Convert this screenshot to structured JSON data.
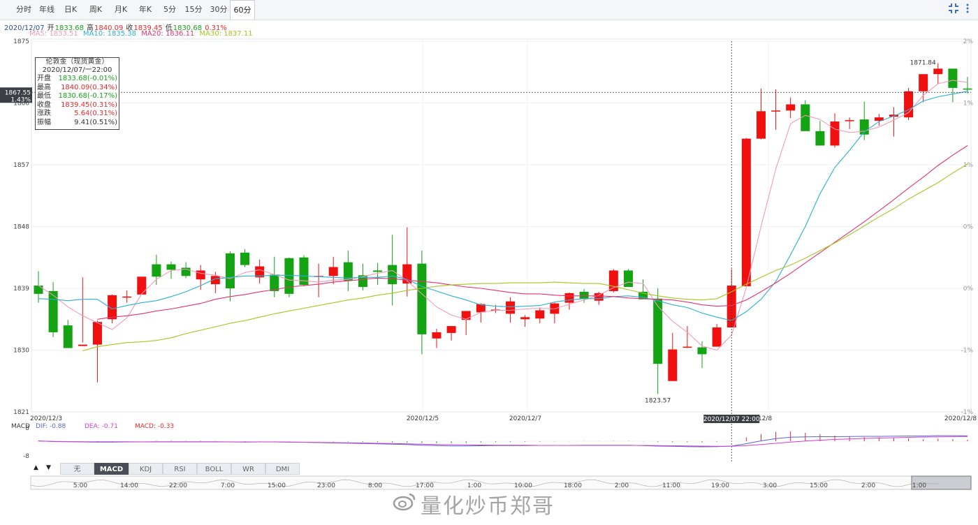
{
  "toolbar": {
    "tabs": [
      "分时",
      "年线",
      "日K",
      "周K",
      "月K",
      "年K",
      "5分",
      "15分",
      "30分",
      "60分"
    ],
    "active": "60分",
    "icons": [
      "fullscreen-icon",
      "more-vertical-icon"
    ]
  },
  "ohlc": {
    "date": "2020/12/07",
    "open_label": "开",
    "open": "1833.68",
    "high_label": "高",
    "high": "1840.09",
    "close_label": "收",
    "close": "1839.45",
    "low_label": "低",
    "low": "1830.68",
    "change": "0.31%"
  },
  "ma": {
    "ma5": "MA5: 1833.51",
    "ma10": "MA10: 1835.38",
    "ma20": "MA20: 1836.11",
    "ma30": "MA30: 1837.11"
  },
  "tooltip": {
    "title": "伦敦金（现货黄金）",
    "datetime": "2020/12/07/一22:00",
    "rows": [
      {
        "label": "开盘",
        "value": "1833.68(-0.01%)",
        "color": "#1aa31a"
      },
      {
        "label": "最高",
        "value": "1840.09(0.34%)",
        "color": "#e8282a"
      },
      {
        "label": "最低",
        "value": "1830.68(-0.17%)",
        "color": "#1aa31a"
      },
      {
        "label": "收盘",
        "value": "1839.45(0.31%)",
        "color": "#e8282a"
      },
      {
        "label": "涨跌",
        "value": "5.64(0.31%)",
        "color": "#e8282a"
      },
      {
        "label": "振幅",
        "value": "9.41(0.51%)",
        "color": "#333333"
      }
    ]
  },
  "crosshair": {
    "price_label": "1867.55",
    "pct_label": "1.43%",
    "time_label": "2020/12/07 22:00"
  },
  "macd_header": {
    "title": "MACD",
    "dif": "DIF: -0.88",
    "dea": "DEA: -0.71",
    "macd": "MACD: -0.33"
  },
  "indicator_tabs": [
    "无",
    "MACD",
    "KDJ",
    "RSI",
    "BOLL",
    "WR",
    "DMI"
  ],
  "indicator_active": "MACD",
  "navigator_labels": [
    "5:00",
    "14:00",
    "22:00",
    "7:00",
    "15:00",
    "23:00",
    "8:00",
    "17:00",
    "1:00",
    "10:00",
    "18:00",
    "2:00",
    "11:00",
    "19:00",
    "3:00",
    "15:00",
    "2:00",
    "1:00"
  ],
  "watermark": "量化炒币郑哥",
  "chart_data": {
    "type": "candlestick",
    "y_ticks": [
      "1875",
      "1866",
      "1857",
      "1848",
      "1839",
      "1830",
      "1821"
    ],
    "pct_ticks": [
      "2%",
      "1%",
      "1%",
      "0%",
      "0%",
      "-1%",
      "-1%"
    ],
    "ylim": [
      1821,
      1875
    ],
    "x_labels": [
      "2020/12/3",
      "2020/12/5",
      "2020/12/7",
      "2020/12/8",
      "2020/12/8"
    ],
    "max_label": "1871.84",
    "min_label": "1823.57",
    "candles": [
      [
        1839.4,
        1841.5,
        1836.9,
        1838.2
      ],
      [
        1838.6,
        1839.9,
        1831.9,
        1832.6
      ],
      [
        1833.6,
        1834.4,
        1830.4,
        1830.3
      ],
      [
        1830.6,
        1840.6,
        1831.1,
        1830.8
      ],
      [
        1830.8,
        1834.3,
        1825.3,
        1834.1
      ],
      [
        1834.5,
        1838.1,
        1833.9,
        1838.0
      ],
      [
        1837.8,
        1838.7,
        1836.9,
        1837.8
      ],
      [
        1838.1,
        1840.4,
        1838.3,
        1840.7
      ],
      [
        1842.5,
        1843.9,
        1839.5,
        1840.7
      ],
      [
        1842.5,
        1842.9,
        1840.4,
        1841.7
      ],
      [
        1842.0,
        1842.8,
        1840.5,
        1840.8
      ],
      [
        1840.3,
        1842.4,
        1838.8,
        1841.6
      ],
      [
        1839.6,
        1841.4,
        1838.3,
        1840.8
      ],
      [
        1844.1,
        1844.4,
        1837.1,
        1839.0
      ],
      [
        1844.2,
        1844.7,
        1842.1,
        1842.4
      ],
      [
        1840.6,
        1843.2,
        1839.7,
        1842.2
      ],
      [
        1841.0,
        1843.6,
        1837.7,
        1838.6
      ],
      [
        1843.4,
        1843.5,
        1837.7,
        1838.2
      ],
      [
        1843.5,
        1843.8,
        1839.3,
        1839.5
      ],
      [
        1840.8,
        1842.6,
        1837.7,
        1840.8
      ],
      [
        1840.8,
        1843.6,
        1839.6,
        1842.1
      ],
      [
        1842.8,
        1844.5,
        1838.6,
        1840.1
      ],
      [
        1840.9,
        1842.6,
        1838.7,
        1839.2
      ],
      [
        1841.6,
        1842.7,
        1839.5,
        1841.4
      ],
      [
        1842.4,
        1846.8,
        1836.5,
        1839.6
      ],
      [
        1839.7,
        1847.9,
        1837.8,
        1842.5
      ],
      [
        1842.6,
        1844.5,
        1829.4,
        1832.3
      ],
      [
        1831.7,
        1833.1,
        1830.3,
        1832.6
      ],
      [
        1832.5,
        1833.5,
        1831.4,
        1833.5
      ],
      [
        1834.4,
        1834.7,
        1832.2,
        1835.7
      ],
      [
        1835.5,
        1836.8,
        1834.0,
        1836.7
      ],
      [
        1835.9,
        1836.6,
        1835.4,
        1835.9
      ],
      [
        1835.3,
        1837.7,
        1834.0,
        1837.1
      ],
      [
        1834.5,
        1835.1,
        1833.4,
        1834.8
      ],
      [
        1834.6,
        1836.2,
        1833.9,
        1835.8
      ],
      [
        1835.3,
        1836.9,
        1833.9,
        1836.8
      ],
      [
        1836.9,
        1838.4,
        1835.9,
        1838.3
      ],
      [
        1838.5,
        1838.9,
        1836.9,
        1837.5
      ],
      [
        1837.2,
        1838.5,
        1836.6,
        1838.3
      ],
      [
        1838.6,
        1841.8,
        1838.4,
        1841.6
      ],
      [
        1841.6,
        1841.8,
        1839.5,
        1839.2
      ],
      [
        1838.5,
        1840.3,
        1837.5,
        1837.4
      ],
      [
        1837.5,
        1839.0,
        1823.6,
        1828.0
      ],
      [
        1825.5,
        1832.5,
        1826.4,
        1830.1
      ],
      [
        1830.5,
        1833.5,
        1830.3,
        1830.5
      ],
      [
        1830.4,
        1831.3,
        1827.4,
        1829.4
      ],
      [
        1830.5,
        1833.8,
        1830.5,
        1833.3
      ],
      [
        1833.3,
        1841.8,
        1834.4,
        1839.4
      ],
      [
        1839.3,
        1860.9,
        1839.6,
        1860.8
      ],
      [
        1860.8,
        1868.1,
        1860.7,
        1864.8
      ],
      [
        1864.8,
        1868.0,
        1862.1,
        1864.9
      ],
      [
        1864.9,
        1866.8,
        1863.8,
        1865.8
      ],
      [
        1865.8,
        1866.4,
        1862.2,
        1861.9
      ],
      [
        1861.9,
        1863.4,
        1860.3,
        1859.8
      ],
      [
        1859.8,
        1864.5,
        1859.5,
        1863.3
      ],
      [
        1863.5,
        1863.9,
        1862.2,
        1863.5
      ],
      [
        1863.6,
        1866.2,
        1860.6,
        1861.4
      ],
      [
        1863.4,
        1864.4,
        1862.7,
        1863.9
      ],
      [
        1864.0,
        1865.4,
        1861.1,
        1864.3
      ],
      [
        1863.9,
        1868.2,
        1863.5,
        1867.7
      ],
      [
        1867.7,
        1870.1,
        1866.1,
        1870.2
      ],
      [
        1870.2,
        1871.8,
        1868.8,
        1871.0
      ],
      [
        1871.0,
        1868.2,
        1866.1,
        1868.2
      ],
      [
        1868.1,
        1869.8,
        1867.4,
        1868.0
      ]
    ],
    "ma_series": [
      {
        "name": "MA5",
        "color": "#f39ab5",
        "values": [
          1839.4,
          1838.0,
          1836.3,
          1835.0,
          1834.0,
          1833.0,
          1834.7,
          1838.2,
          1840.3,
          1841.6,
          1841.8,
          1841.2,
          1840.9,
          1840.4,
          1841.3,
          1841.7,
          1841.0,
          1840.2,
          1840.1,
          1839.9,
          1840.2,
          1840.3,
          1840.7,
          1841.2,
          1841.6,
          1840.1,
          1838.2,
          1836.3,
          1835.1,
          1834.5,
          1835.5,
          1835.8,
          1835.8,
          1836.0,
          1836.1,
          1836.0,
          1836.7,
          1837.3,
          1838.0,
          1839.1,
          1839.9,
          1839.7,
          1836.4,
          1834.2,
          1832.6,
          1830.6,
          1830.0,
          1832.2,
          1839.1,
          1848.0,
          1856.4,
          1863.0,
          1864.2,
          1863.6,
          1862.2,
          1861.7,
          1861.9,
          1862.5,
          1863.5,
          1864.6,
          1867.1,
          1868.8,
          1869.3,
          1869.0
        ]
      },
      {
        "name": "MA10",
        "color": "#2bb0d6",
        "values": [
          1837.5,
          1837.4,
          1837.2,
          1837.4,
          1837.4,
          1836.0,
          1836.5,
          1836.9,
          1837.2,
          1837.8,
          1838.5,
          1839.4,
          1840.4,
          1840.6,
          1840.8,
          1840.8,
          1840.9,
          1840.9,
          1840.8,
          1840.7,
          1840.6,
          1840.5,
          1840.6,
          1840.6,
          1840.8,
          1840.3,
          1839.3,
          1838.6,
          1837.9,
          1837.3,
          1836.6,
          1836.4,
          1836.3,
          1836.4,
          1836.5,
          1837.0,
          1837.3,
          1837.5,
          1837.5,
          1837.8,
          1837.9,
          1837.7,
          1837.2,
          1836.6,
          1836.2,
          1835.4,
          1834.8,
          1834.3,
          1835.6,
          1837.4,
          1840.0,
          1843.9,
          1848.0,
          1852.8,
          1856.6,
          1859.1,
          1861.8,
          1863.3,
          1864.1,
          1865.0,
          1866.3,
          1866.9,
          1867.3,
          1867.7
        ]
      },
      {
        "name": "MA20",
        "color": "#e8326f",
        "values": [
          1834.5,
          1834.8,
          1835.0,
          1835.3,
          1835.7,
          1836.0,
          1836.4,
          1836.8,
          1837.4,
          1837.8,
          1838.1,
          1838.5,
          1838.8,
          1839.2,
          1839.4,
          1839.6,
          1839.9,
          1840.1,
          1840.3,
          1840.5,
          1840.4,
          1840.2,
          1840.0,
          1839.8,
          1839.5,
          1839.2,
          1839.0,
          1838.7,
          1838.4,
          1838.2,
          1838.2,
          1838.0,
          1837.9,
          1837.9,
          1837.9,
          1837.8,
          1837.6,
          1837.5,
          1837.4,
          1837.3,
          1837.0,
          1836.6,
          1836.4,
          1836.5,
          1837.3,
          1838.5,
          1839.8,
          1841.2,
          1842.7,
          1844.2,
          1845.7,
          1847.2,
          1848.7,
          1850.3,
          1851.9,
          1853.6,
          1855.2,
          1856.9,
          1858.4,
          1859.8
        ]
      },
      {
        "name": "MA30",
        "color": "#a6c620",
        "values": [
          1829.9,
          1830.5,
          1830.8,
          1831.1,
          1831.2,
          1831.4,
          1831.8,
          1832.4,
          1832.9,
          1833.4,
          1833.9,
          1834.3,
          1834.8,
          1835.3,
          1835.7,
          1836.1,
          1836.5,
          1836.9,
          1837.3,
          1837.6,
          1838.0,
          1838.3,
          1838.7,
          1839.0,
          1839.3,
          1839.5,
          1839.6,
          1839.7,
          1839.7,
          1839.8,
          1839.8,
          1839.8,
          1839.9,
          1839.8,
          1839.7,
          1839.7,
          1839.3,
          1838.8,
          1838.3,
          1837.9,
          1837.6,
          1837.4,
          1837.3,
          1837.5,
          1838.5,
          1839.6,
          1840.6,
          1841.6,
          1842.4,
          1843.4,
          1844.5,
          1845.6,
          1846.8,
          1848.1,
          1849.4,
          1850.6,
          1852.0,
          1853.2,
          1854.4,
          1855.8,
          1857.1
        ]
      }
    ],
    "macd": {
      "yticks": [
        "8",
        "-8"
      ],
      "ylim": [
        -8,
        8
      ],
      "dif": [
        0.2,
        -0.2,
        -0.3,
        -0.4,
        -0.5,
        -0.5,
        -0.4,
        -0.4,
        -0.3,
        -0.3,
        -0.3,
        -0.3,
        -0.3,
        -0.4,
        -0.5,
        -0.4,
        -0.4,
        -0.5,
        -0.6,
        -0.8,
        -1.0,
        -1.1,
        -1.3,
        -1.5,
        -1.7,
        -1.9,
        -2.3,
        -2.5,
        -2.7,
        -2.7,
        -2.6,
        -2.5,
        -2.5,
        -2.5,
        -2.4,
        -2.4,
        -2.4,
        -2.3,
        -2.3,
        -2.3,
        -2.3,
        -2.5,
        -2.8,
        -2.9,
        -3.1,
        -3.2,
        -3.1,
        -2.8,
        -1.4,
        0.2,
        1.5,
        2.3,
        2.5,
        2.6,
        2.6,
        2.7,
        2.8,
        2.8,
        2.9,
        3.0,
        3.0,
        3.2,
        3.2,
        3.1
      ],
      "dea": [
        0.1,
        -0.1,
        -0.2,
        -0.3,
        -0.3,
        -0.3,
        -0.3,
        -0.4,
        -0.4,
        -0.4,
        -0.4,
        -0.4,
        -0.4,
        -0.4,
        -0.4,
        -0.4,
        -0.4,
        -0.5,
        -0.6,
        -0.7,
        -0.8,
        -0.9,
        -1.0,
        -1.2,
        -1.3,
        -1.5,
        -1.7,
        -1.9,
        -2.0,
        -2.1,
        -2.2,
        -2.3,
        -2.3,
        -2.3,
        -2.4,
        -2.4,
        -2.4,
        -2.4,
        -2.4,
        -2.4,
        -2.4,
        -2.4,
        -2.5,
        -2.6,
        -2.7,
        -2.8,
        -2.9,
        -2.9,
        -2.5,
        -1.9,
        -1.2,
        -0.5,
        0.1,
        0.6,
        1.0,
        1.3,
        1.6,
        1.8,
        2.0,
        2.2,
        2.4,
        2.5,
        2.6,
        2.7
      ],
      "hist": [
        0.2,
        -0.2,
        -0.3,
        -0.3,
        -0.3,
        -0.3,
        -0.2,
        -0.1,
        0.2,
        0.2,
        0.2,
        0.2,
        0.1,
        -0.1,
        -0.2,
        -0.1,
        -0.1,
        -0.1,
        -0.1,
        -0.2,
        -0.3,
        -0.3,
        -0.4,
        -0.5,
        -0.7,
        -0.9,
        -1.1,
        -1.2,
        -1.2,
        -1.1,
        -0.8,
        -0.5,
        -0.4,
        -0.4,
        -0.3,
        -0.2,
        -0.1,
        0.1,
        0.1,
        0.2,
        0.2,
        -0.1,
        -0.5,
        -0.6,
        -0.6,
        -0.7,
        -0.4,
        -0.1,
        2.2,
        4.1,
        5.4,
        5.6,
        4.8,
        4.1,
        3.3,
        2.8,
        2.4,
        2.2,
        1.9,
        1.6,
        1.2,
        1.4,
        1.2,
        0.9
      ]
    }
  }
}
